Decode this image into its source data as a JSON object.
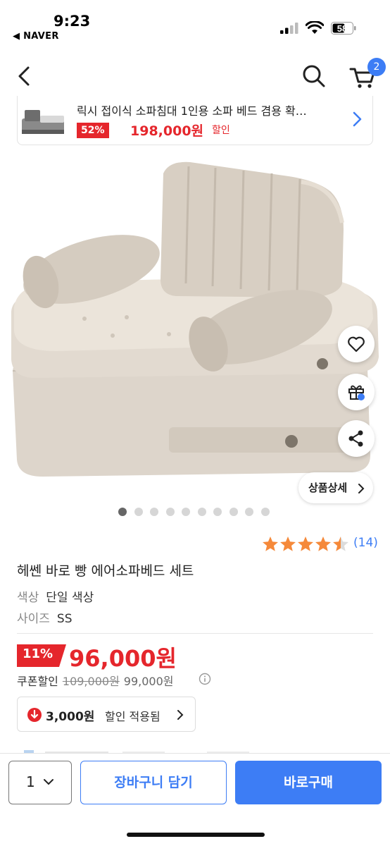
{
  "status_bar": {
    "time": "9:23",
    "back_app": "◀ NAVER",
    "battery": "58"
  },
  "nav": {
    "back_icon": "chevron-left-icon",
    "search_icon": "search-icon",
    "cart_icon": "cart-icon",
    "cart_badge": "2"
  },
  "recommended": {
    "title": "릭시 접이식 소파침대 1인용 소파 베드 겸용 확…",
    "discount": "52%",
    "price": "198,000원",
    "tag": "할인"
  },
  "gallery": {
    "total": 10,
    "active_index": 0,
    "detail_label": "상품상세"
  },
  "product": {
    "rating": 4.5,
    "review_count": "(14)",
    "name": "헤쎈 바로 빵 에어소파베드 세트",
    "options": [
      {
        "key": "색상",
        "value": "단일 색상"
      },
      {
        "key": "사이즈",
        "value": "SS"
      }
    ],
    "discount": "11%",
    "price": "96,000원",
    "coupon_label": "쿠폰할인",
    "original_price": "109,000원",
    "coupon_price": "99,000원",
    "applied_amount": "3,000원",
    "applied_label": "할인 적용됨"
  },
  "bottom_bar": {
    "quantity": "1",
    "cart_button": "장바구니 담기",
    "buy_button": "바로구매"
  },
  "colors": {
    "accent": "#3d7df5",
    "sale": "#e5262c",
    "star": "#f5893a"
  }
}
